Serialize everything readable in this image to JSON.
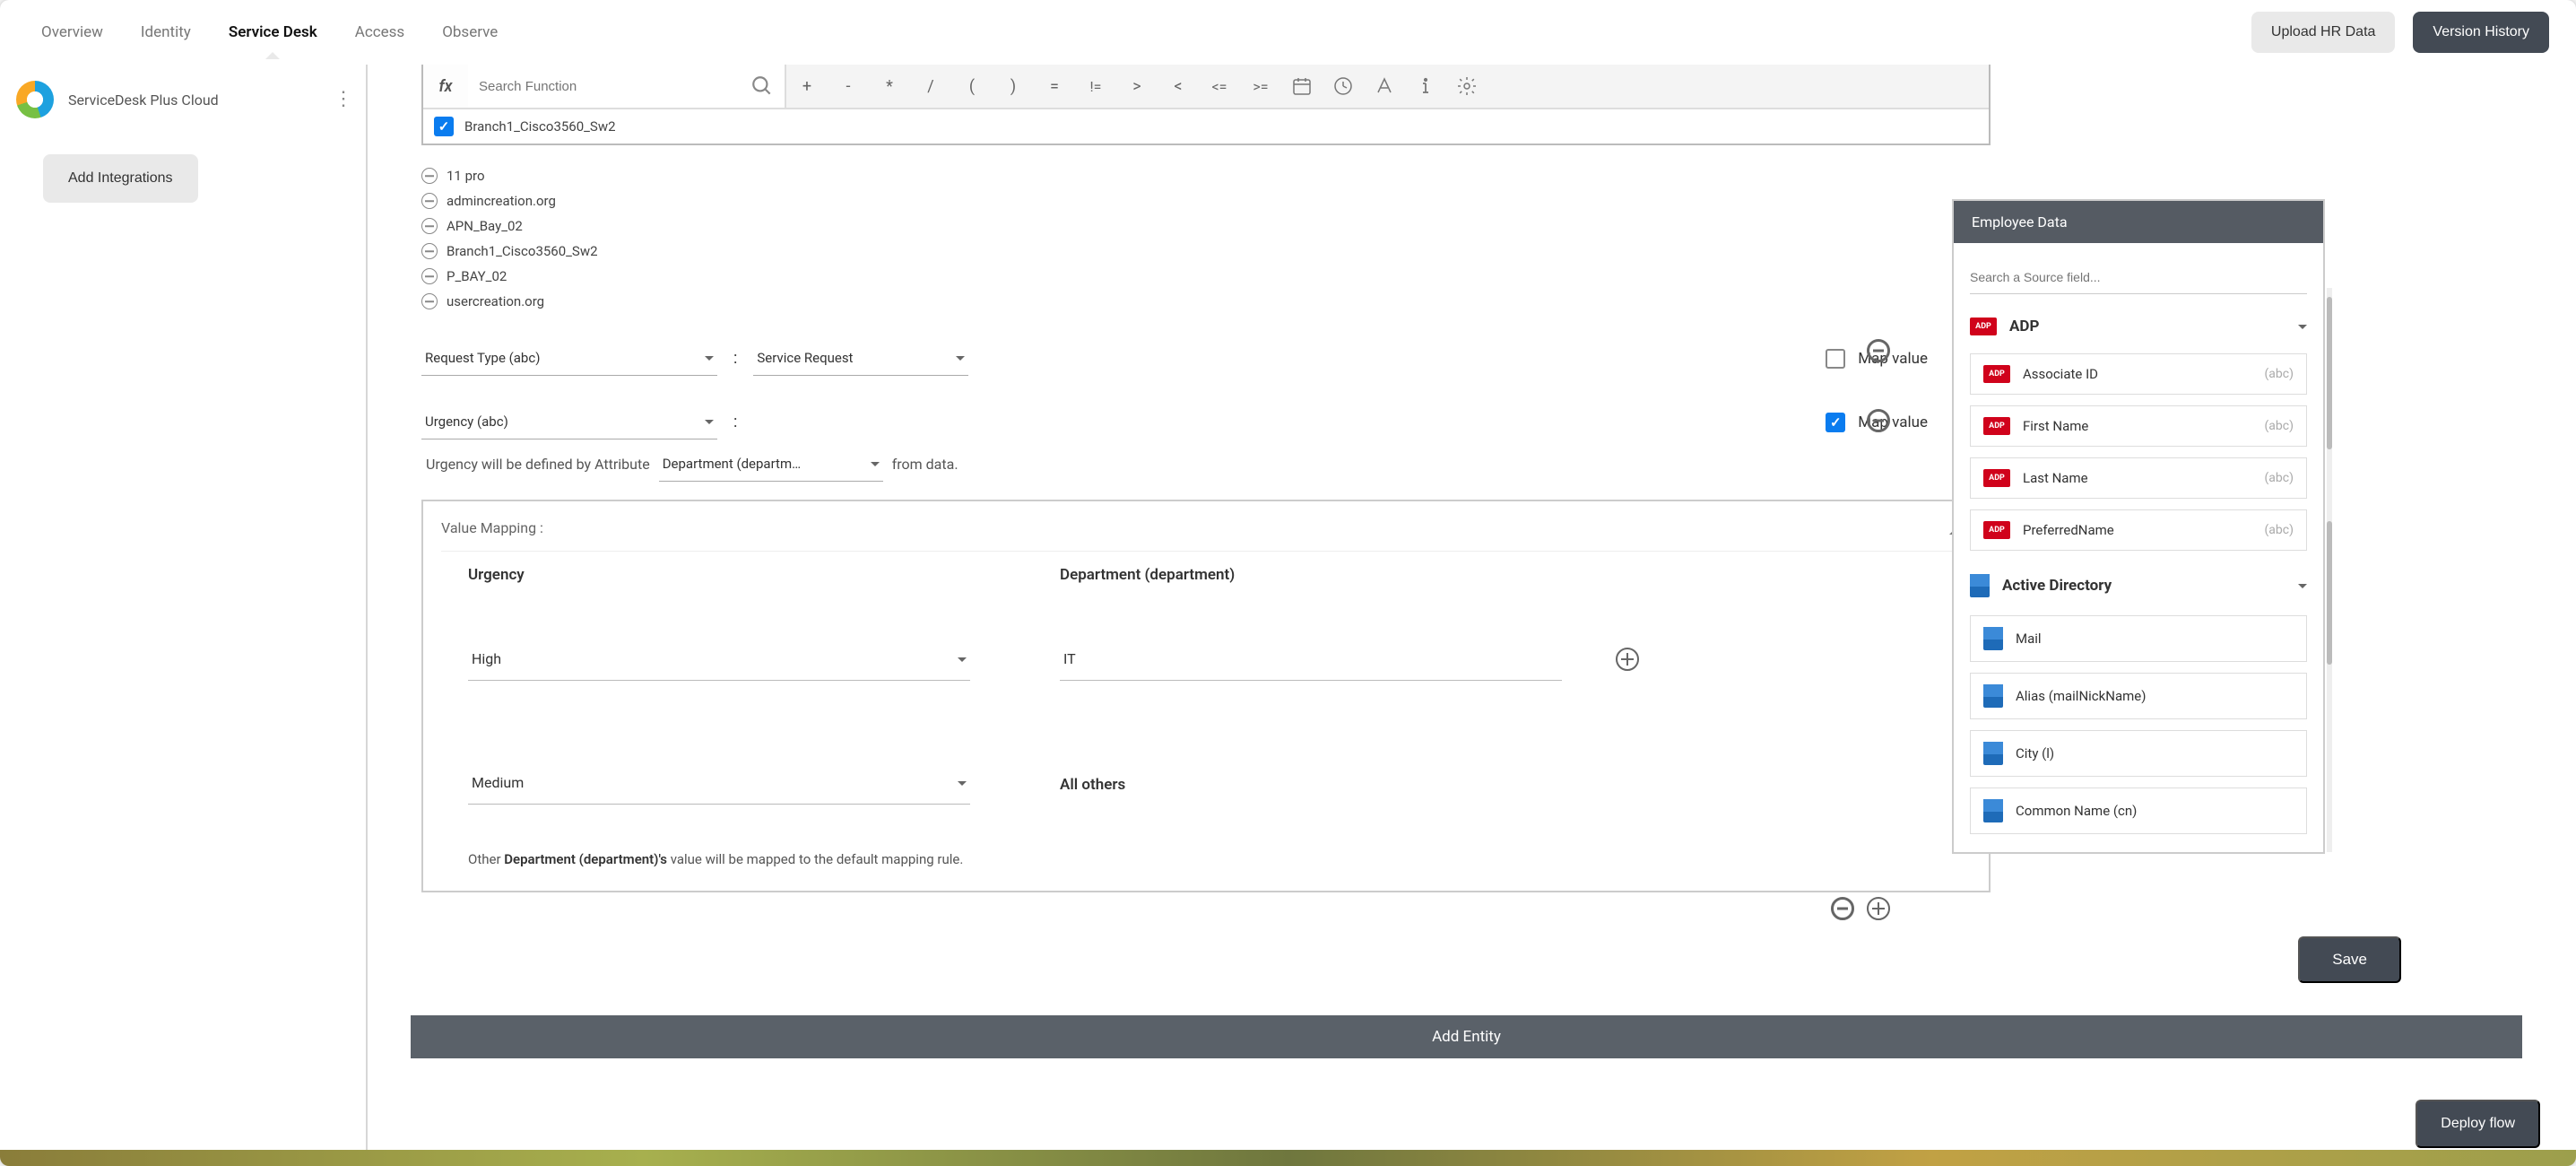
{
  "topnav": {
    "items": [
      "Overview",
      "Identity",
      "Service Desk",
      "Access",
      "Observe"
    ],
    "upload_hr": "Upload HR Data",
    "version_history": "Version History"
  },
  "sidebar": {
    "brand": "ServiceDesk Plus Cloud",
    "add_integrations": "Add Integrations"
  },
  "toolbar": {
    "search_placeholder": "Search Function",
    "ops_text": [
      "+",
      "-",
      "*",
      "/",
      "(",
      ")",
      "=",
      "!=",
      ">",
      "<",
      "<=",
      ">="
    ],
    "checked_strike_label": "Branch1_Cisco3560_Sw2"
  },
  "list_items": [
    "11 pro",
    "admincreation.org",
    "APN_Bay_02",
    "Branch1_Cisco3560_Sw2",
    "P_BAY_02",
    "usercreation.org"
  ],
  "row1": {
    "field_label": "Request Type (abc)",
    "value_label": "Service Request",
    "map_value": "Map value"
  },
  "row2": {
    "field_label": "Urgency (abc)",
    "map_value": "Map value"
  },
  "sentence": {
    "pre": "Urgency will be defined by Attribute",
    "sel": "Department (departm…",
    "post": "from data."
  },
  "value_mapping": {
    "header": "Value Mapping  :",
    "col1": "Urgency",
    "col2": "Department (department)",
    "r1_urgency": "High",
    "r1_dept": "IT",
    "r2_urgency": "Medium",
    "all_others": "All others",
    "info_pre": "Other ",
    "info_bold": "Department (department)'s",
    "info_post": " value will be mapped to the default mapping rule."
  },
  "emp_panel": {
    "title": "Employee Data",
    "search_placeholder": "Search a Source field...",
    "adp": {
      "title": "ADP",
      "items": [
        {
          "label": "Associate ID",
          "type": "(abc)"
        },
        {
          "label": "First Name",
          "type": "(abc)"
        },
        {
          "label": "Last Name",
          "type": "(abc)"
        },
        {
          "label": "PreferredName",
          "type": "(abc)"
        }
      ]
    },
    "ad": {
      "title": "Active Directory",
      "items": [
        {
          "label": "Mail"
        },
        {
          "label": "Alias (mailNickName)"
        },
        {
          "label": "City (l)"
        },
        {
          "label": "Common Name (cn)"
        }
      ]
    }
  },
  "buttons": {
    "add_entity": "Add Entity",
    "save": "Save",
    "deploy_flow": "Deploy flow"
  }
}
